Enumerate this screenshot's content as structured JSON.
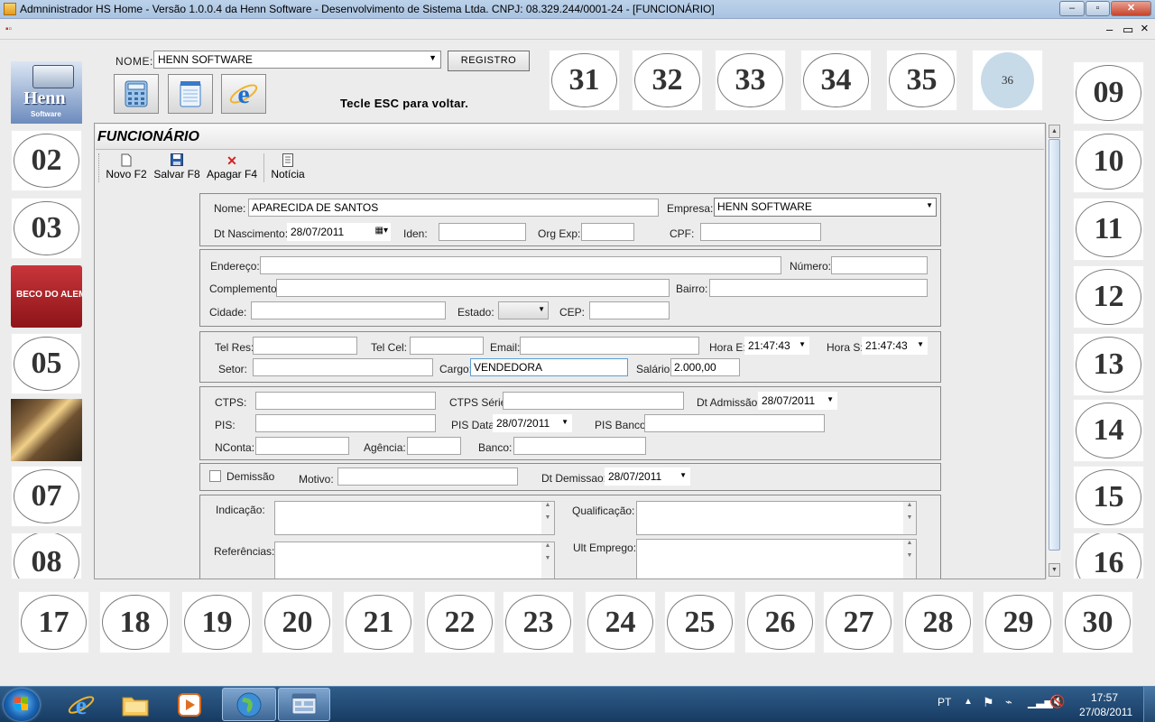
{
  "window": {
    "title": "Admninistrador HS Home - Versão 1.0.0.4 da Henn Software - Desenvolvimento de Sistema Ltda. CNPJ: 08.329.244/0001-24 - [FUNCIONÁRIO]",
    "minimize": "–",
    "maximize": "▫",
    "close": "✕"
  },
  "mdi": {
    "minimize": "–",
    "restore": "▭",
    "close": "×"
  },
  "top": {
    "nome_label": "NOME:",
    "nome_value": "HENN SOFTWARE",
    "registro_button": "REGISTRO",
    "hint": "Tecle ESC para voltar."
  },
  "tiles": {
    "henn_name": "Henn",
    "henn_sub": "Software",
    "beco": "BECO DO ALEMÃO"
  },
  "circles": {
    "top": [
      "31",
      "32",
      "33",
      "34",
      "35",
      "36"
    ],
    "left": [
      "02",
      "03",
      "05",
      "07",
      "08"
    ],
    "right": [
      "09",
      "10",
      "11",
      "12",
      "13",
      "14",
      "15",
      "16"
    ],
    "bottom": [
      "17",
      "18",
      "19",
      "20",
      "21",
      "22",
      "23",
      "24",
      "25",
      "26",
      "27",
      "28",
      "29",
      "30"
    ]
  },
  "form": {
    "title": "FUNCIONÁRIO",
    "toolbar": {
      "novo": "Novo F2",
      "salvar": "Salvar F8",
      "apagar": "Apagar F4",
      "noticia": "Notícia"
    },
    "id": {
      "nome_label": "Nome:",
      "nome": "APARECIDA DE SANTOS",
      "empresa_label": "Empresa:",
      "empresa": "HENN SOFTWARE",
      "nasc_label": "Dt Nascimento:",
      "nasc": "28/07/2011",
      "iden_label": "Iden:",
      "orgexp_label": "Org Exp:",
      "cpf_label": "CPF:"
    },
    "address": {
      "endereco_label": "Endereço:",
      "numero_label": "Número:",
      "complemento_label": "Complemento:",
      "bairro_label": "Bairro:",
      "cidade_label": "Cidade:",
      "estado_label": "Estado:",
      "cep_label": "CEP:"
    },
    "contact": {
      "telres_label": "Tel Res:",
      "telcel_label": "Tel Cel:",
      "email_label": "Email:",
      "horae_label": "Hora E:",
      "horae": "21:47:43",
      "horas_label": "Hora S:",
      "horas": "21:47:43",
      "setor_label": "Setor:",
      "cargo_label": "Cargo:",
      "cargo": "VENDEDORA",
      "salario_label": "Salário:",
      "salario": "2.000,00"
    },
    "work": {
      "ctps_label": "CTPS:",
      "ctpsserie_label": "CTPS Série:",
      "admissao_label": "Dt Admissão:",
      "admissao": "28/07/2011",
      "pis_label": "PIS:",
      "pisdata_label": "PIS Data:",
      "pisdata": "28/07/2011",
      "pisbanco_label": "PIS Banco:",
      "nconta_label": "NConta:",
      "agencia_label": "Agência:",
      "banco_label": "Banco:"
    },
    "demissao": {
      "check_label": "Demissão",
      "motivo_label": "Motivo:",
      "dt_label": "Dt Demissao:",
      "dt": "28/07/2011"
    },
    "notes": {
      "indicacao_label": "Indicação:",
      "qualificacao_label": "Qualificação:",
      "referencias_label": "Referências:",
      "ultemprego_label": "Ult Emprego:"
    }
  },
  "taskbar": {
    "lang": "PT",
    "time": "17:57",
    "date": "27/08/2011"
  }
}
